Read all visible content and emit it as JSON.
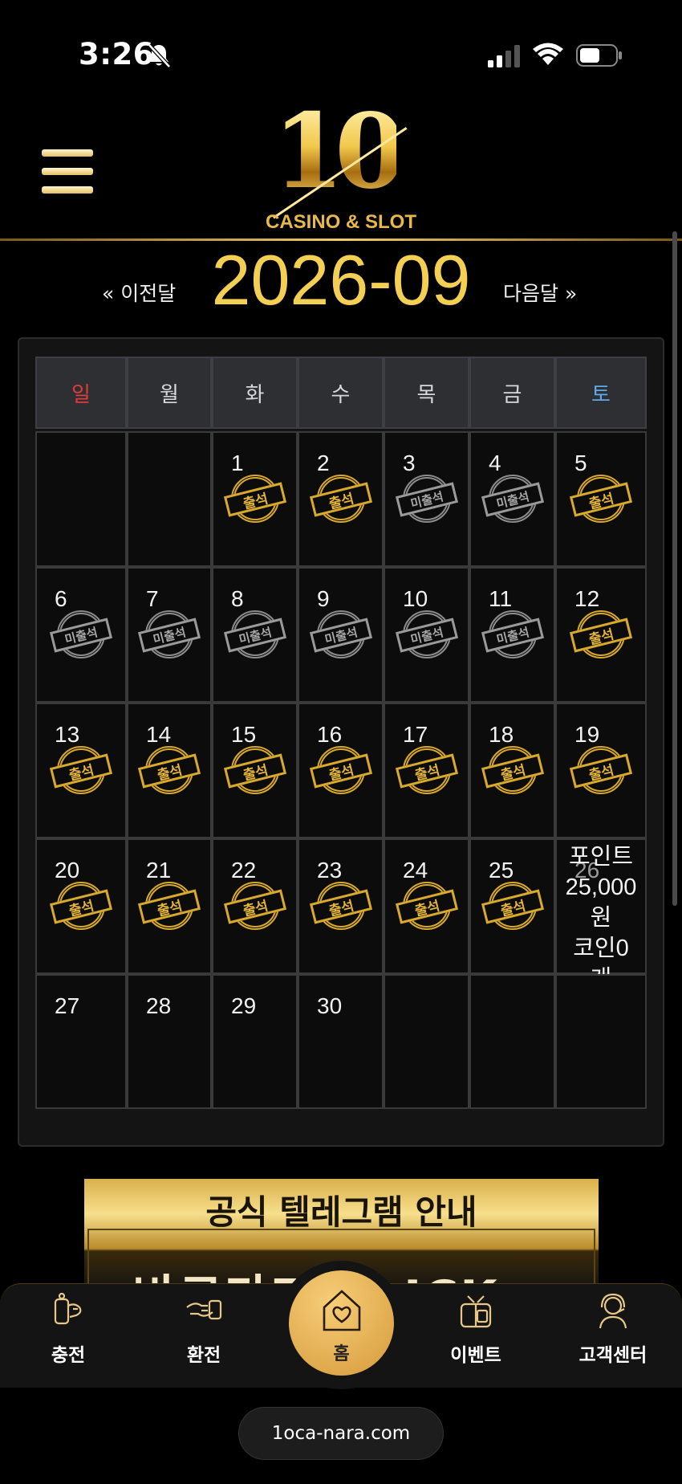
{
  "status_bar": {
    "time": "3:26"
  },
  "header": {
    "logo_number": "10",
    "logo_subtitle": "CASINO & SLOT"
  },
  "calendar": {
    "prev_label": "« 이전달",
    "next_label": "다음달 »",
    "month": "2026-09",
    "weekdays": [
      "일",
      "월",
      "화",
      "수",
      "목",
      "금",
      "토"
    ],
    "stamp_attended": "출석",
    "stamp_missed": "미출석",
    "days": [
      {
        "day": ""
      },
      {
        "day": ""
      },
      {
        "day": "1",
        "status": "attended"
      },
      {
        "day": "2",
        "status": "attended"
      },
      {
        "day": "3",
        "status": "missed"
      },
      {
        "day": "4",
        "status": "missed"
      },
      {
        "day": "5",
        "status": "attended"
      },
      {
        "day": "6",
        "status": "missed"
      },
      {
        "day": "7",
        "status": "missed"
      },
      {
        "day": "8",
        "status": "missed"
      },
      {
        "day": "9",
        "status": "missed"
      },
      {
        "day": "10",
        "status": "missed"
      },
      {
        "day": "11",
        "status": "missed"
      },
      {
        "day": "12",
        "status": "attended"
      },
      {
        "day": "13",
        "status": "attended"
      },
      {
        "day": "14",
        "status": "attended"
      },
      {
        "day": "15",
        "status": "attended"
      },
      {
        "day": "16",
        "status": "attended"
      },
      {
        "day": "17",
        "status": "attended"
      },
      {
        "day": "18",
        "status": "attended"
      },
      {
        "day": "19",
        "status": "attended"
      },
      {
        "day": "20",
        "status": "attended"
      },
      {
        "day": "21",
        "status": "attended"
      },
      {
        "day": "22",
        "status": "attended"
      },
      {
        "day": "23",
        "status": "attended"
      },
      {
        "day": "24",
        "status": "attended"
      },
      {
        "day": "25",
        "status": "attended"
      },
      {
        "day": "26",
        "status": "today"
      },
      {
        "day": "27"
      },
      {
        "day": "28"
      },
      {
        "day": "29"
      },
      {
        "day": "30"
      },
      {
        "day": ""
      },
      {
        "day": ""
      },
      {
        "day": ""
      }
    ],
    "today_reward": {
      "line1": "포인트",
      "line2": "25,000",
      "line3": "원",
      "line4": "코인0",
      "line5": "개"
    }
  },
  "banner": {
    "title": "공식 텔레그램 안내",
    "subtitle": "바로가기 CLICK"
  },
  "bottom_nav": {
    "charge": "충전",
    "exchange": "환전",
    "home": "홈",
    "event": "이벤트",
    "support": "고객센터"
  },
  "browser": {
    "url": "1oca-nara.com"
  },
  "colors": {
    "gold": "#f3cf54",
    "sunday": "#e23b3b",
    "saturday": "#5fa8ea"
  }
}
